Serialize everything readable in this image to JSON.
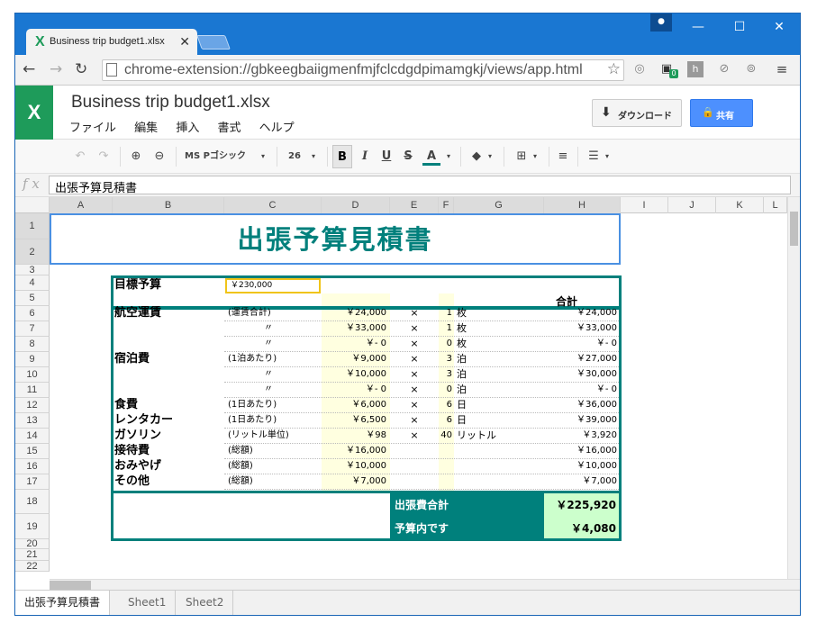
{
  "browser": {
    "tab_title": "Business trip budget1.xlsx",
    "url": "chrome-extension://gbkeegbaiigmenfmjfclcdgdpimamgkj/views/app.html",
    "ext_badge": "0"
  },
  "app": {
    "file_title": "Business trip budget1.xlsx",
    "menus": [
      "ファイル",
      "編集",
      "挿入",
      "書式",
      "ヘルプ"
    ],
    "download_label": "ダウンロード",
    "share_label": "共有"
  },
  "toolbar": {
    "font_name": "MS Pゴシック",
    "font_size": "26",
    "bold": "B",
    "italic": "I",
    "underline": "U",
    "strike": "S",
    "text_color": "A",
    "text_color_value": "#00807c"
  },
  "formula": {
    "fx": "f x",
    "content": "出張予算見積書"
  },
  "columns": [
    "A",
    "B",
    "C",
    "D",
    "E",
    "F",
    "G",
    "H",
    "I",
    "J",
    "K",
    "L"
  ],
  "rows": [
    "1",
    "2",
    "3",
    "4",
    "5",
    "6",
    "7",
    "8",
    "9",
    "10",
    "11",
    "12",
    "13",
    "14",
    "15",
    "16",
    "17",
    "18",
    "19",
    "20",
    "21",
    "22"
  ],
  "sheet": {
    "title": "出張予算見積書",
    "target_label": "目標予算",
    "target_value": "￥230,000",
    "total_header": "合計",
    "items": [
      {
        "cat": "航空運賃",
        "note": "(運賃合計)",
        "price": "￥24,000",
        "x": "×",
        "qty": "1",
        "unit": "枚",
        "total": "￥24,000"
      },
      {
        "cat": "",
        "note": "〃",
        "price": "￥33,000",
        "x": "×",
        "qty": "1",
        "unit": "枚",
        "total": "￥33,000"
      },
      {
        "cat": "",
        "note": "〃",
        "price": "￥- 0",
        "x": "×",
        "qty": "0",
        "unit": "枚",
        "total": "￥- 0"
      },
      {
        "cat": "宿泊費",
        "note": "(1泊あたり)",
        "price": "￥9,000",
        "x": "×",
        "qty": "3",
        "unit": "泊",
        "total": "￥27,000"
      },
      {
        "cat": "",
        "note": "〃",
        "price": "￥10,000",
        "x": "×",
        "qty": "3",
        "unit": "泊",
        "total": "￥30,000"
      },
      {
        "cat": "",
        "note": "〃",
        "price": "￥- 0",
        "x": "×",
        "qty": "0",
        "unit": "泊",
        "total": "￥- 0"
      },
      {
        "cat": "食費",
        "note": "(1日あたり)",
        "price": "￥6,000",
        "x": "×",
        "qty": "6",
        "unit": "日",
        "total": "￥36,000"
      },
      {
        "cat": "レンタカー",
        "note": "(1日あたり)",
        "price": "￥6,500",
        "x": "×",
        "qty": "6",
        "unit": "日",
        "total": "￥39,000"
      },
      {
        "cat": "ガソリン",
        "note": "(リットル単位)",
        "price": "￥98",
        "x": "×",
        "qty": "40",
        "unit": "リットル",
        "total": "￥3,920"
      },
      {
        "cat": "接待費",
        "note": "(総額)",
        "price": "￥16,000",
        "x": "",
        "qty": "",
        "unit": "",
        "total": "￥16,000"
      },
      {
        "cat": "おみやげ",
        "note": "(総額)",
        "price": "￥10,000",
        "x": "",
        "qty": "",
        "unit": "",
        "total": "￥10,000"
      },
      {
        "cat": "その他",
        "note": "(総額)",
        "price": "￥7,000",
        "x": "",
        "qty": "",
        "unit": "",
        "total": "￥7,000"
      }
    ],
    "sum_label": "出張費合計",
    "sum_value": "￥225,920",
    "result_label": "予算内です",
    "result_value": "￥4,080"
  },
  "sheet_tabs": [
    "出張予算見積書",
    "Sheet1",
    "Sheet2"
  ],
  "colors": {
    "teal": "#00807c",
    "chrome_blue": "#1a77d2",
    "green": "#1e9b5a",
    "selection": "#4a90e2"
  }
}
